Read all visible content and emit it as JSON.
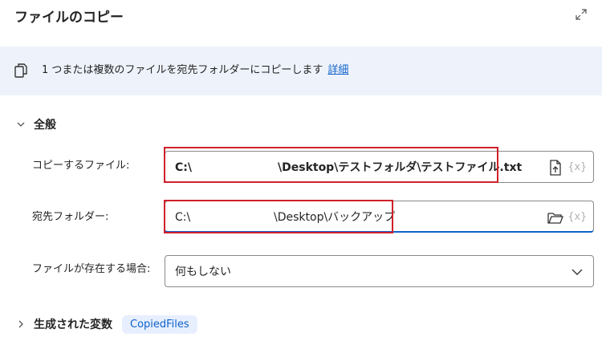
{
  "header": {
    "title": "ファイルのコピー"
  },
  "info": {
    "description": "1 つまたは複数のファイルを宛先フォルダーにコピーします",
    "details_link": "詳細"
  },
  "general": {
    "label": "全般",
    "files_to_copy": {
      "label": "コピーするファイル:",
      "value_drive": "C:\\",
      "value_path": "\\Desktop\\テストフォルダ\\テストファイル.txt",
      "var_label": "{x}"
    },
    "destination": {
      "label": "宛先フォルダー:",
      "value_drive": "C:\\",
      "value_path": "\\Desktop\\バックアップ",
      "var_label": "{x}"
    },
    "if_exists": {
      "label": "ファイルが存在する場合:",
      "value": "何もしない"
    }
  },
  "variables": {
    "label": "生成された変数",
    "chip": "CopiedFiles"
  }
}
